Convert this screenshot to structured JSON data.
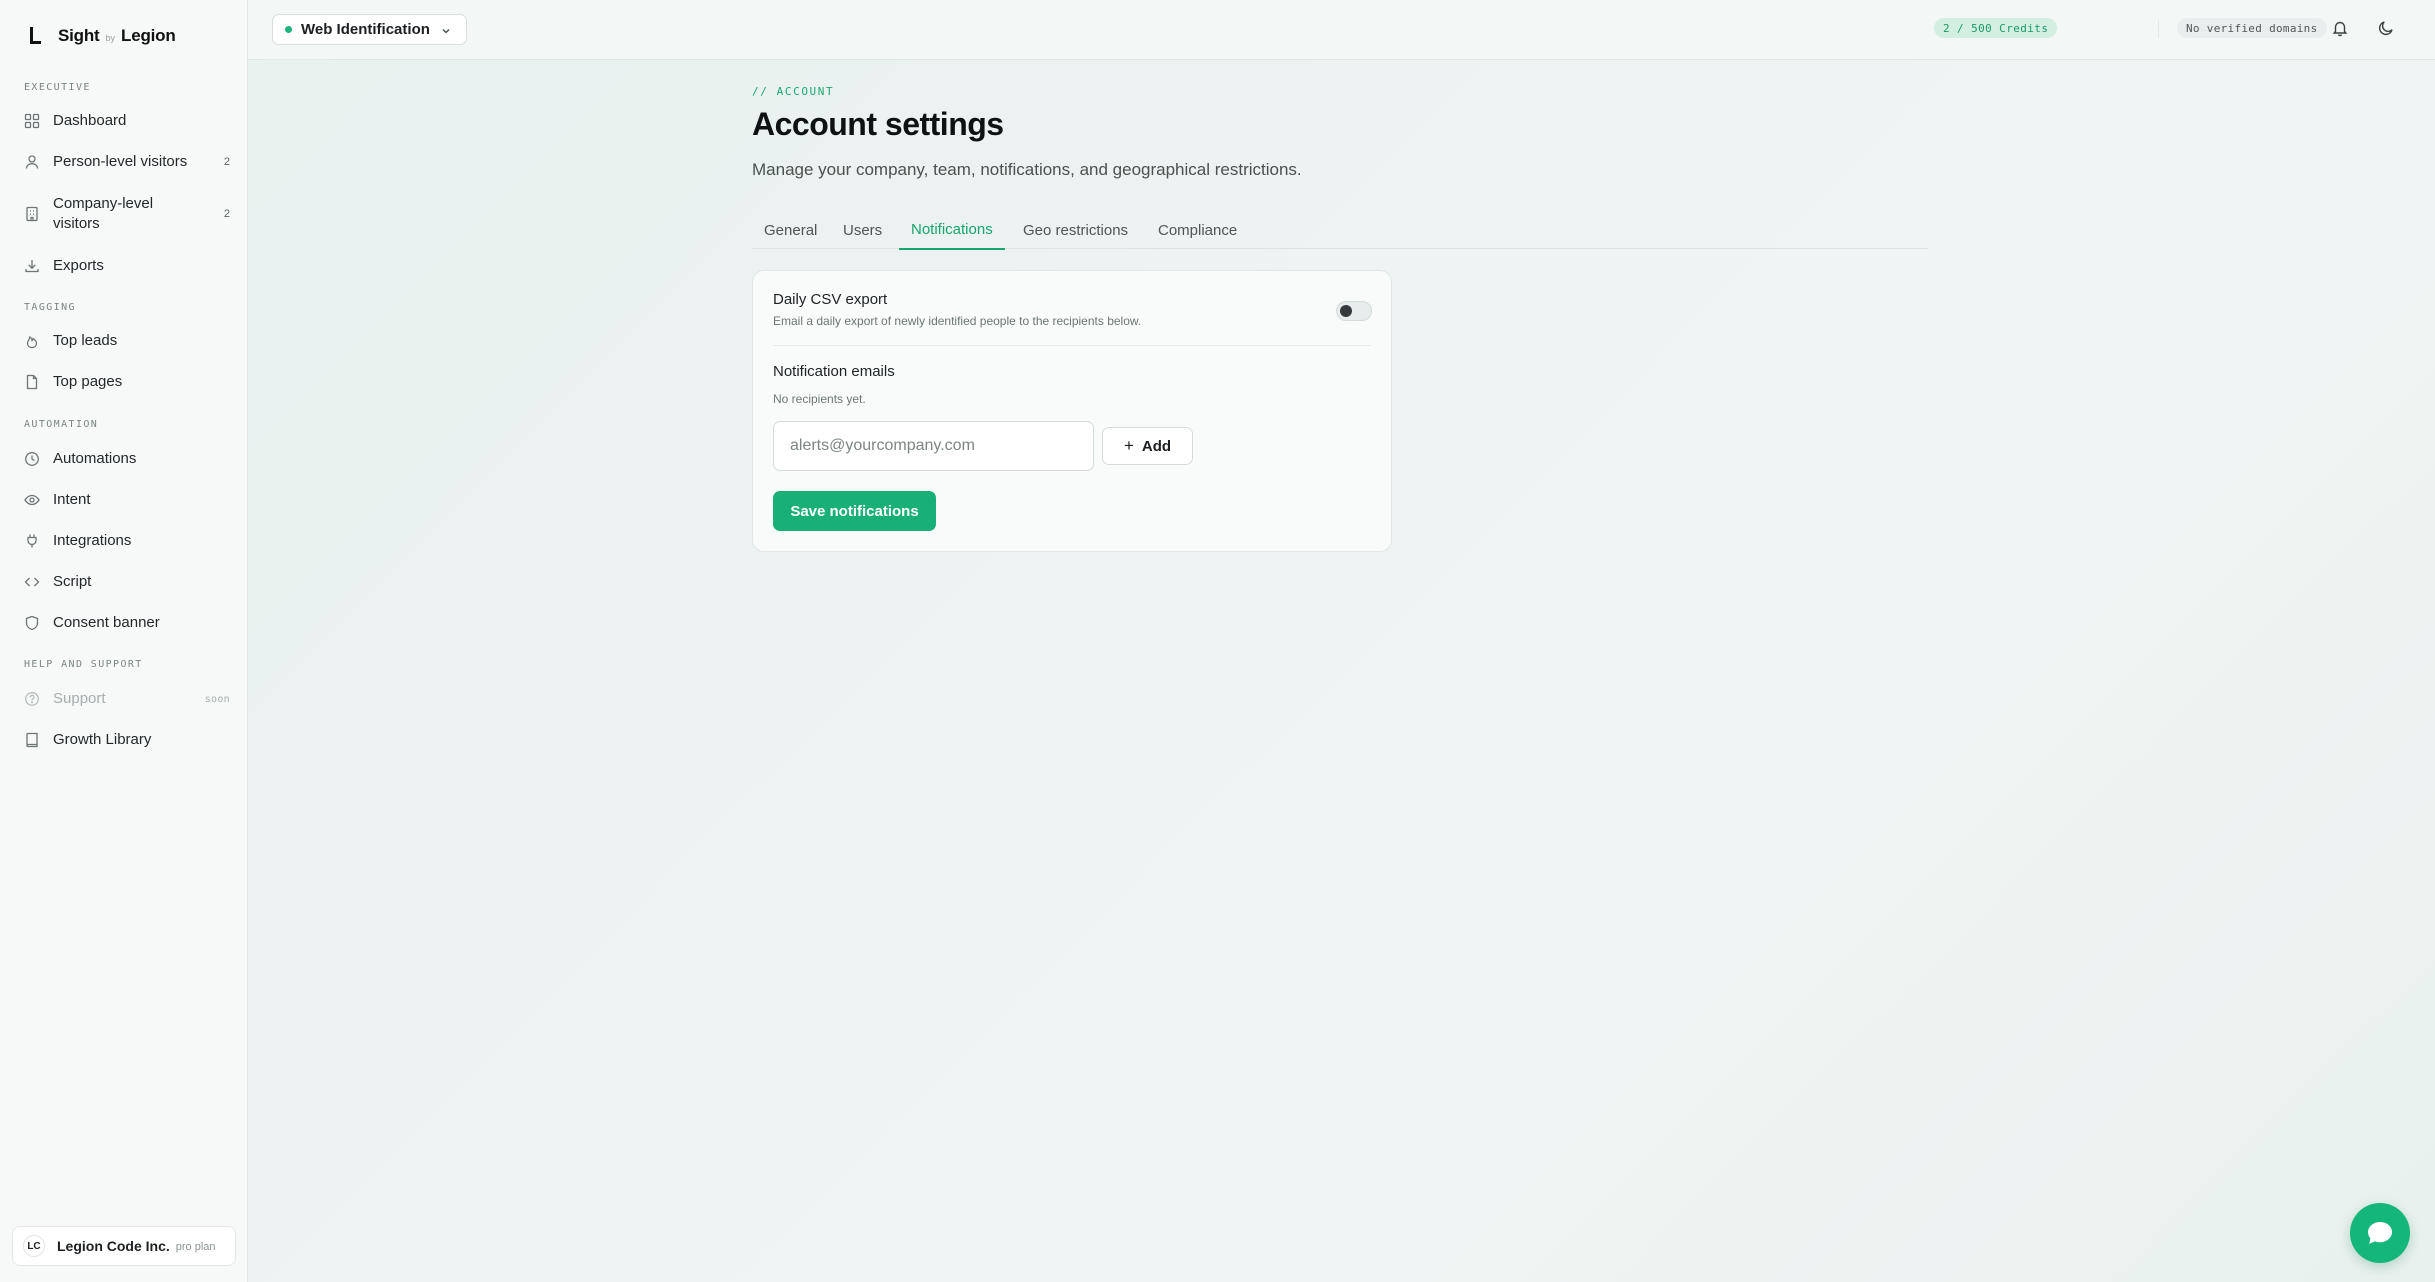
{
  "brand": {
    "name_left": "Sight",
    "by": "by",
    "name_right": "Legion"
  },
  "sidebar": {
    "sections": [
      {
        "title": "EXECUTIVE"
      },
      {
        "title": "TAGGING"
      },
      {
        "title": "AUTOMATION"
      },
      {
        "title": "HELP AND SUPPORT"
      }
    ],
    "items": [
      {
        "label": "Dashboard",
        "icon": "grid-icon"
      },
      {
        "label": "Person-level visitors",
        "count": "2",
        "icon": "user-icon"
      },
      {
        "label": "Company-level visitors",
        "count": "2",
        "icon": "building-icon"
      },
      {
        "label": "Exports",
        "icon": "download-icon"
      },
      {
        "label": "Top leads",
        "icon": "flame-icon"
      },
      {
        "label": "Top pages",
        "icon": "file-icon"
      },
      {
        "label": "Automations",
        "icon": "clock-icon"
      },
      {
        "label": "Intent",
        "icon": "eye-icon"
      },
      {
        "label": "Integrations",
        "icon": "plug-icon"
      },
      {
        "label": "Script",
        "icon": "code-icon"
      },
      {
        "label": "Consent banner",
        "icon": "shield-icon"
      },
      {
        "label": "Support",
        "badge": "soon",
        "icon": "help-circle-icon",
        "disabled": true
      },
      {
        "label": "Growth Library",
        "icon": "book-icon"
      }
    ],
    "org": {
      "initials": "LC",
      "name": "Legion Code Inc.",
      "plan": "pro plan"
    }
  },
  "topbar": {
    "workspace": "Web Identification",
    "credits": "2 / 500 Credits",
    "domains": "No verified domains"
  },
  "page": {
    "eyebrow": "// ACCOUNT",
    "title": "Account settings",
    "subtitle": "Manage your company, team, notifications, and geographical restrictions.",
    "tabs": [
      {
        "label": "General"
      },
      {
        "label": "Users"
      },
      {
        "label": "Notifications",
        "active": true
      },
      {
        "label": "Geo restrictions"
      },
      {
        "label": "Compliance"
      }
    ]
  },
  "notifications": {
    "daily_export_title": "Daily CSV export",
    "daily_export_desc": "Email a daily export of newly identified people to the recipients below.",
    "daily_export_enabled": false,
    "emails_title": "Notification emails",
    "empty_text": "No recipients yet.",
    "email_placeholder": "alerts@yourcompany.com",
    "email_value": "",
    "add_label": "Add",
    "save_label": "Save notifications"
  },
  "colors": {
    "accent": "#18b077",
    "accent_text": "#17a56d",
    "credits_bg": "#d3efe2"
  }
}
